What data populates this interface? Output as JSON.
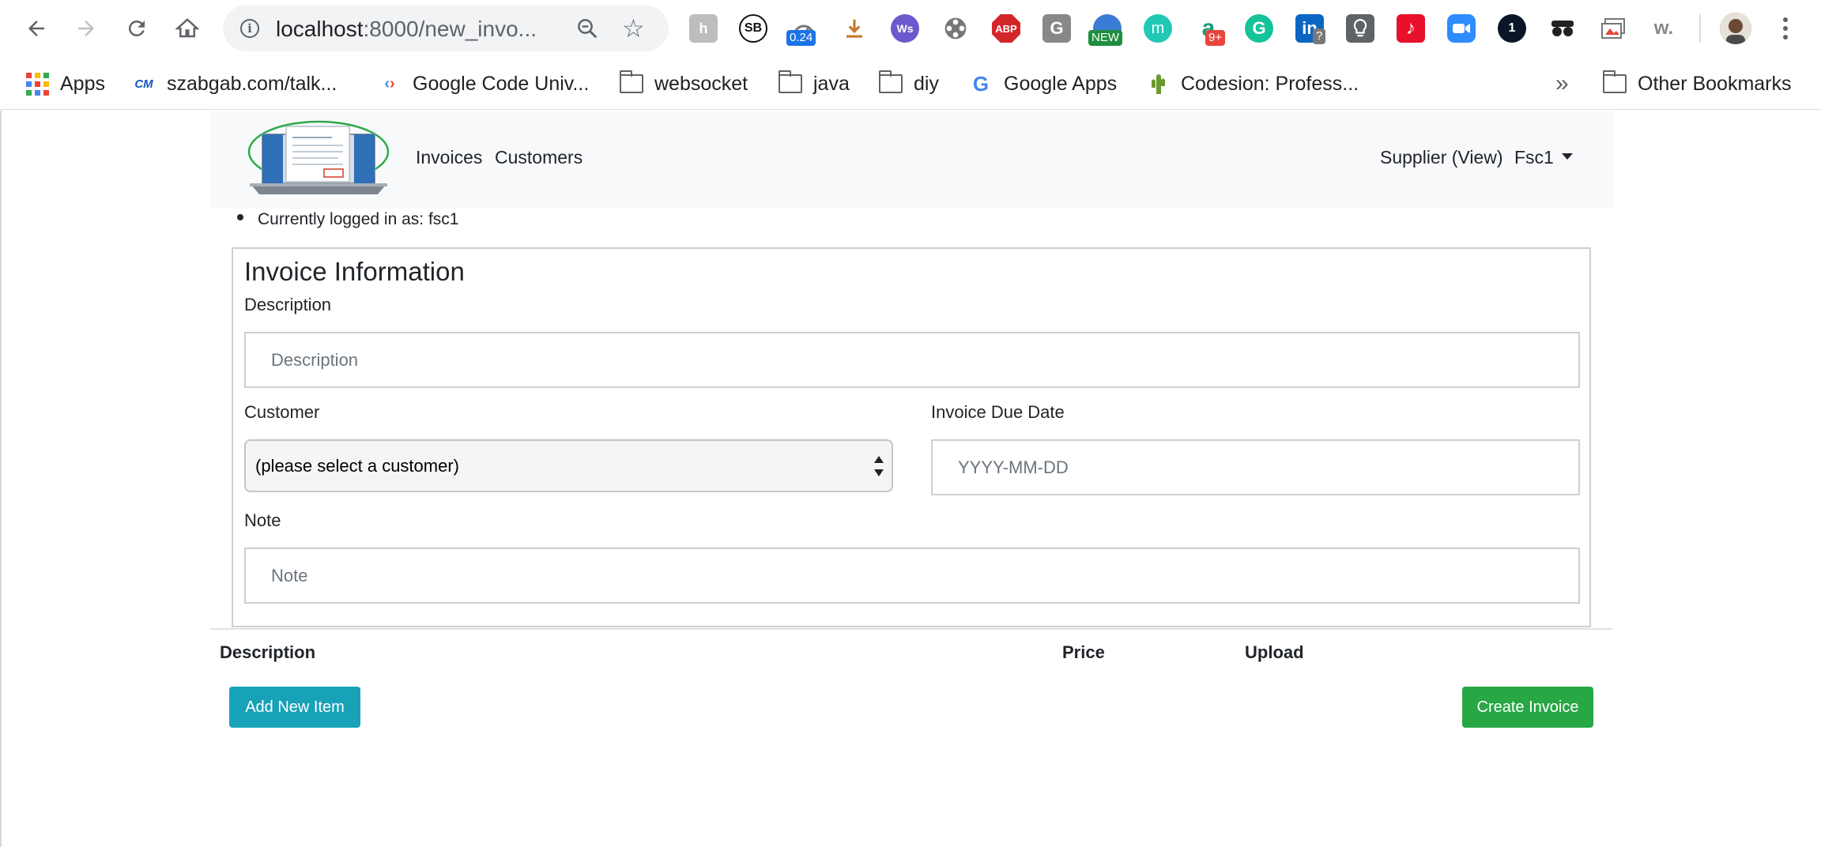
{
  "browser": {
    "url_host": "localhost",
    "url_path": ":8000/new_invo...",
    "extensions": [
      {
        "name": "hypothesis-ext-icon",
        "glyph": "h",
        "bg": "#b5b5b5"
      },
      {
        "name": "sb-ext-icon",
        "glyph": "SB",
        "bg": "#ffffff"
      },
      {
        "name": "speed-ext-icon",
        "glyph": "",
        "badge": "0.24",
        "badge_color": "#1a73e8"
      },
      {
        "name": "download-ext-icon",
        "glyph": "⭳",
        "bg": "#ffffff"
      },
      {
        "name": "ws-ext-icon",
        "glyph": "Ws",
        "bg": "#6a5acd"
      },
      {
        "name": "film-reel-ext-icon",
        "glyph": "",
        "bg": "#ffffff"
      },
      {
        "name": "adblock-plus-icon",
        "glyph": "ABP",
        "bg": "#d3262b"
      },
      {
        "name": "g-ext-icon",
        "glyph": "G",
        "bg": "#888888"
      },
      {
        "name": "globe-ext-icon",
        "glyph": "",
        "badge": "NEW",
        "badge_color": "#1e8e3e"
      },
      {
        "name": "m-ext-icon",
        "glyph": "m",
        "bg": "#21c8b6"
      },
      {
        "name": "a-ext-icon",
        "glyph": "a",
        "badge": "9+",
        "badge_color": "#e8453c"
      },
      {
        "name": "grammarly-icon",
        "glyph": "G",
        "bg": "#15c39a"
      },
      {
        "name": "linkedin-ext-icon",
        "glyph": "in",
        "badge": "?",
        "badge_color": "#777777"
      },
      {
        "name": "lightbulb-ext-icon",
        "glyph": "",
        "bg": "#5f6368"
      },
      {
        "name": "music-ext-icon",
        "glyph": "♪",
        "bg": "#e8102a"
      },
      {
        "name": "zoom-video-icon",
        "glyph": "",
        "bg": "#2d8cff"
      },
      {
        "name": "onepassword-icon",
        "glyph": "1",
        "bg": "#0a1628"
      },
      {
        "name": "glasses-ext-icon",
        "glyph": "",
        "bg": "#ffffff"
      },
      {
        "name": "photos-ext-icon",
        "glyph": "",
        "bg": "#ffffff"
      },
      {
        "name": "w-ext-icon",
        "glyph": "w.",
        "bg": "#ffffff"
      }
    ],
    "bookmarks": [
      {
        "label": "Apps"
      },
      {
        "label": "szabgab.com/talk..."
      },
      {
        "label": "Google Code Univ..."
      },
      {
        "label": "websocket"
      },
      {
        "label": "java"
      },
      {
        "label": "diy"
      },
      {
        "label": "Google Apps"
      },
      {
        "label": "Codesion: Profess..."
      }
    ],
    "overflow": "»",
    "other_bookmarks": "Other Bookmarks"
  },
  "navbar": {
    "links": [
      "Invoices",
      "Customers"
    ],
    "supplier": "Supplier (View)",
    "user_menu": "Fsc1"
  },
  "status": {
    "logged_in": "Currently logged in as: fsc1"
  },
  "form": {
    "title": "Invoice Information",
    "description_label": "Description",
    "description_placeholder": "Description",
    "customer_label": "Customer",
    "customer_selected": "(please select a customer)",
    "due_date_label": "Invoice Due Date",
    "due_date_placeholder": "YYYY-MM-DD",
    "note_label": "Note",
    "note_placeholder": "Note"
  },
  "items_table": {
    "headers": [
      "Description",
      "Price",
      "Upload"
    ]
  },
  "actions": {
    "add_item": "Add New Item",
    "create_invoice": "Create Invoice"
  },
  "colors": {
    "add_button": "#17a2b8",
    "create_button": "#28a745",
    "navbar_bg": "#f8f9fa"
  }
}
